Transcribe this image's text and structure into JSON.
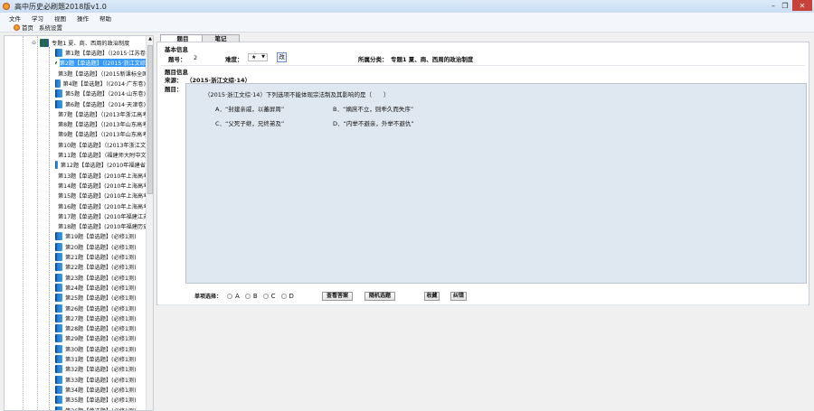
{
  "window": {
    "title": "高中历史必刷题2018版v1.0",
    "minimize": "–",
    "restore": "❐",
    "close": "✕"
  },
  "menu": [
    "文件",
    "学习",
    "视图",
    "操作",
    "帮助"
  ],
  "toolbar": {
    "home": "首页",
    "settings": "系统设置"
  },
  "tree": {
    "root": "专题1 夏、商、西周的政治制度",
    "selected_index": 1,
    "items": [
      "第1题【单选题】（(2015·江苏卷",
      "第2题【单选题】（(2015·浙江文综",
      "第3题【单选题】（(2015新课标全国卷",
      "第4题【单选题】（(2014·广东卷)",
      "第5题【单选题】（2014·山东卷)",
      "第6题【单选题】（2014·天津卷)",
      "第7题【单选题】（(2013年浙江高考",
      "第8题【单选题】（(2013年山东高考",
      "第9题【单选题】（(2013年山东高考",
      "第10题【单选题】（(2013年浙江文",
      "第11题【单选题】（福建师大附中文综",
      "第12题【单选题】(2010年福建省",
      "第13题【单选题】(2010年上海高考",
      "第14题【单选题】(2010年上海高考",
      "第15题【单选题】(2010年上海高考",
      "第16题【单选题】(2010年上海高考",
      "第17题【单选题】(2010年福建江苏",
      "第18题【单选题】(2010年福建历史",
      "第19题【单选题】(必修1测)",
      "第20题【单选题】(必修1测)",
      "第21题【单选题】(必修1测)",
      "第22题【单选题】(必修1测)",
      "第23题【单选题】(必修1测)",
      "第24题【单选题】(必修1测)",
      "第25题【单选题】(必修1测)",
      "第26题【单选题】(必修1测)",
      "第27题【单选题】(必修1测)",
      "第28题【单选题】(必修1测)",
      "第29题【单选题】(必修1测)",
      "第30题【单选题】(必修1测)",
      "第31题【单选题】(必修1测)",
      "第32题【单选题】(必修1测)",
      "第33题【单选题】(必修1测)",
      "第34题【单选题】(必修1测)",
      "第35题【单选题】(必修1测)",
      "第36题【单选题】(必修1测)"
    ]
  },
  "tabs": [
    "题目",
    "笔记"
  ],
  "basic": {
    "heading": "基本信息",
    "num_label": "题号：",
    "num": "2",
    "diff_label": "难度：",
    "diff": "★",
    "change": "改",
    "cat_label": "所属分类：",
    "cat": "专题1 夏、商、西周的政治制度"
  },
  "qinfo": {
    "heading": "题目信息",
    "src_label": "来源：",
    "src": "（2015·浙江文综·14）",
    "q_label": "题目：",
    "stem": "（2015·浙江文综·14）下列选项不能体现宗法制及其影响的是（　　）",
    "options": [
      "A．“封建亲戚，以蕃屏周”",
      "B．“嫡庶不立，则乖久而失序”",
      "C．“父死子继，兄终弟及”",
      "D．“内举不避亲，外举不避仇”"
    ]
  },
  "answer": {
    "label": "单项选择：",
    "choices": [
      "A",
      "B",
      "C",
      "D"
    ],
    "view": "查看答案",
    "random": "随机选题",
    "fav": "收藏",
    "report": "纠错"
  }
}
